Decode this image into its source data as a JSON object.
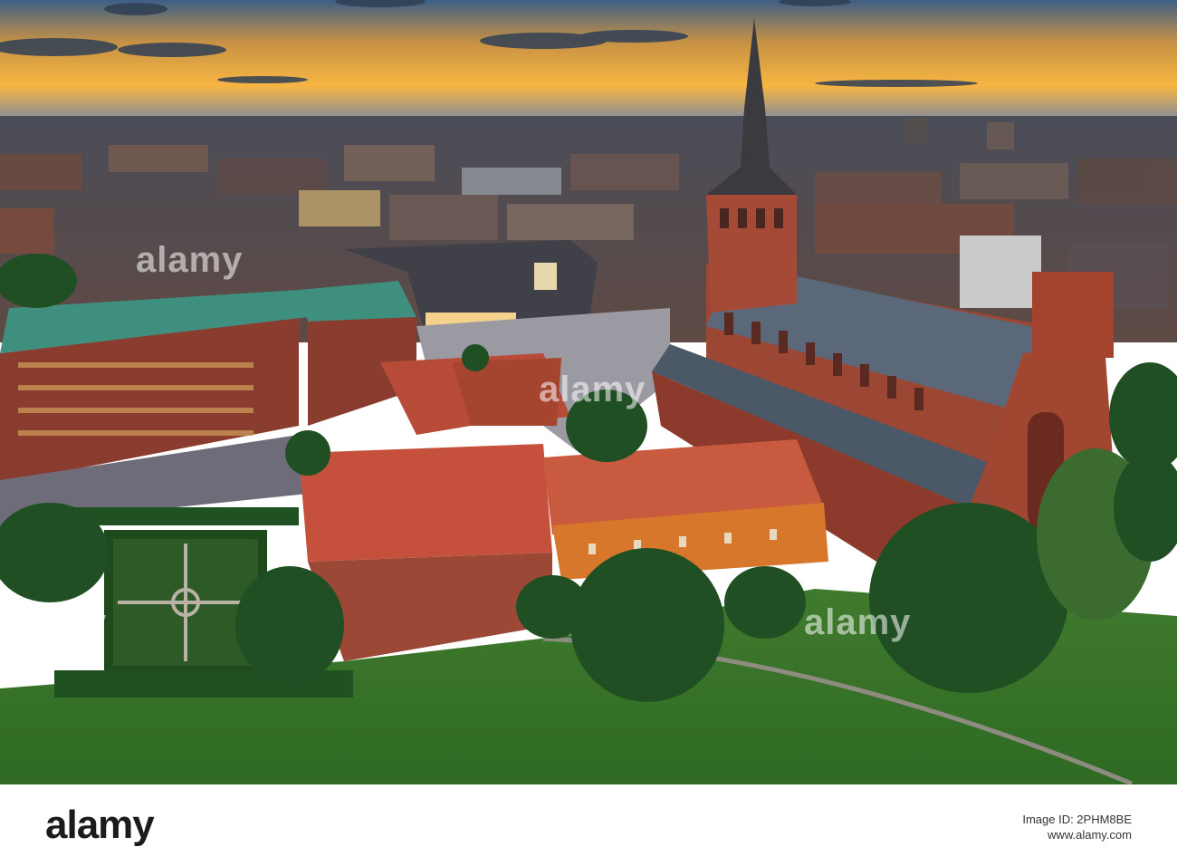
{
  "watermark": {
    "text_top": "alamy",
    "text_mid": "alamy",
    "text_left": "alamy",
    "text_right": "alamy"
  },
  "footer": {
    "logo": "alamy",
    "image_id_label": "Image ID: 2PHM8BE",
    "site": "www.alamy.com"
  }
}
